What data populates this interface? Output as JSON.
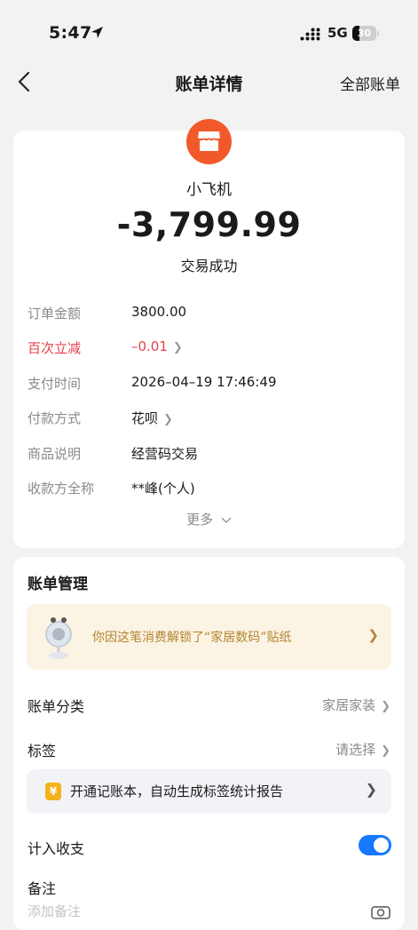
{
  "status": {
    "time": "5:47",
    "network": "5G",
    "battery_level": 30,
    "battery_text": "30"
  },
  "nav": {
    "title": "账单详情",
    "right_label": "全部账单"
  },
  "transaction": {
    "merchant": "小飞机",
    "amount": "-3,799.99",
    "status": "交易成功",
    "rows": [
      {
        "label": "订单金额",
        "value": "3800.00"
      },
      {
        "label": "百次立减",
        "value": "–0.01"
      },
      {
        "label": "支付时间",
        "value": "2026–04–19 17:46:49"
      },
      {
        "label": "付款方式",
        "value": "花呗"
      },
      {
        "label": "商品说明",
        "value": "经营码交易"
      },
      {
        "label": "收款方全称",
        "value": "**峰(个人)"
      }
    ],
    "more_label": "更多"
  },
  "manage": {
    "title": "账单管理",
    "sticker_text": "你因这笔消费解锁了“家居数码”贴纸",
    "category_label": "账单分类",
    "category_value": "家居家装",
    "tag_label": "标签",
    "tag_value": "请选择",
    "tip_icon_text": "¥",
    "tip_text": "开通记账本，自动生成标签统计报告",
    "include_label": "计入收支",
    "include_on": true,
    "note_label": "备注",
    "note_placeholder": "添加备注"
  },
  "colors": {
    "accent": "#1677ff",
    "merchant_logo": "#f2592a",
    "discount_red": "#e8424c",
    "sticker_gold": "#b5852e"
  }
}
